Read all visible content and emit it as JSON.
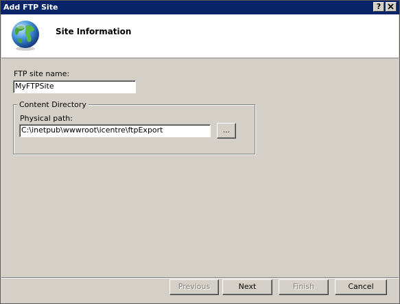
{
  "window": {
    "title": "Add FTP Site",
    "help_label": "?",
    "close_label": "✕"
  },
  "header": {
    "title": "Site Information",
    "icon": "globe-icon"
  },
  "form": {
    "site_name_label": "FTP site name:",
    "site_name_value": "MyFTPSite",
    "content_group_label": "Content Directory",
    "physical_path_label": "Physical path:",
    "physical_path_value": "C:\\inetpub\\wwwroot\\icentre\\ftpExport",
    "browse_label": "..."
  },
  "footer": {
    "previous_label": "Previous",
    "next_label": "Next",
    "finish_label": "Finish",
    "cancel_label": "Cancel"
  },
  "colors": {
    "titlebar": "#0a246a",
    "face": "#d4d0c8"
  }
}
